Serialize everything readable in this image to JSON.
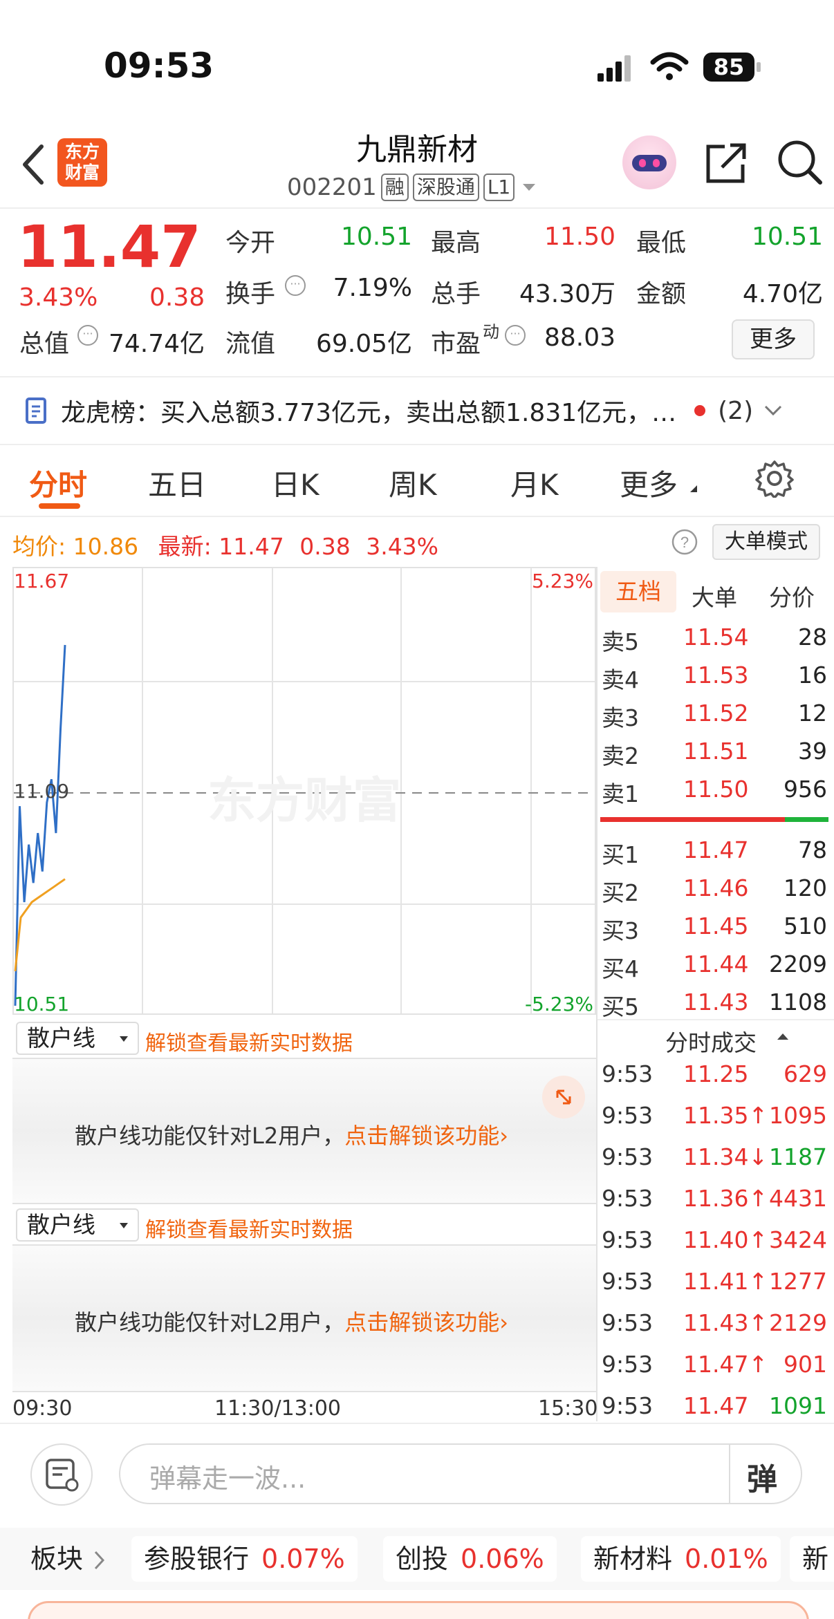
{
  "status_bar": {
    "time": "09:53",
    "battery": "85"
  },
  "header": {
    "title": "九鼎新材",
    "code": "002201",
    "tags": [
      "融",
      "深股通",
      "L1"
    ],
    "logo_text": "东方财富"
  },
  "quote": {
    "price": "11.47",
    "change_pct": "3.43%",
    "change": "0.38",
    "stats": [
      {
        "label": "今开",
        "value": "10.51",
        "color": "#13a32c"
      },
      {
        "label": "最高",
        "value": "11.50",
        "color": "#e8312e"
      },
      {
        "label": "最低",
        "value": "10.51",
        "color": "#13a32c"
      },
      {
        "label": "换手",
        "value": "7.19%",
        "color": "#222222"
      },
      {
        "label": "总手",
        "value": "43.30万",
        "color": "#222222"
      },
      {
        "label": "金额",
        "value": "4.70亿",
        "color": "#222222"
      },
      {
        "label": "总值",
        "value": "74.74亿",
        "color": "#222222"
      },
      {
        "label": "流值",
        "value": "69.05亿",
        "color": "#222222"
      },
      {
        "label": "市盈",
        "value": "88.03",
        "color": "#222222"
      }
    ],
    "pe_sup": "动",
    "more_label": "更多"
  },
  "dragon_tiger": {
    "text": "龙虎榜：买入总额3.773亿元，卖出总额1.831亿元，…",
    "count": "(2)"
  },
  "tabs": [
    "分时",
    "五日",
    "日K",
    "周K",
    "月K",
    "更多"
  ],
  "info_row": {
    "avg_label": "均价:",
    "avg_value": "10.86",
    "latest_label": "最新:",
    "latest_value": "11.47",
    "change": "0.38",
    "change_pct": "3.43%",
    "mode_button": "大单模式"
  },
  "chart": {
    "y_top": "11.67",
    "y_mid": "11.09",
    "y_bottom": "10.51",
    "pct_top": "5.23%",
    "pct_bottom": "-5.23%",
    "watermark": "东方财富",
    "x_labels": [
      "09:30",
      "11:30/13:00",
      "15:30"
    ]
  },
  "chart_data": {
    "type": "line",
    "x_range": [
      "09:30",
      "15:30"
    ],
    "ylim": [
      10.51,
      11.67
    ],
    "series": [
      {
        "values": [
          10.53,
          11.05,
          10.8,
          10.95,
          10.85,
          10.98,
          10.88,
          11.06,
          11.12,
          10.98,
          11.25,
          11.47
        ]
      },
      {
        "values": [
          10.62,
          10.76,
          10.78,
          10.8,
          10.81,
          10.82,
          10.83,
          10.84,
          10.85,
          10.86
        ]
      }
    ]
  },
  "order_book": {
    "tabs": [
      "五档",
      "大单",
      "分价"
    ],
    "asks": [
      {
        "label": "卖5",
        "price": "11.54",
        "vol": "28"
      },
      {
        "label": "卖4",
        "price": "11.53",
        "vol": "16"
      },
      {
        "label": "卖3",
        "price": "11.52",
        "vol": "12"
      },
      {
        "label": "卖2",
        "price": "11.51",
        "vol": "39"
      },
      {
        "label": "卖1",
        "price": "11.50",
        "vol": "956"
      }
    ],
    "bids": [
      {
        "label": "买1",
        "price": "11.47",
        "vol": "78"
      },
      {
        "label": "买2",
        "price": "11.46",
        "vol": "120"
      },
      {
        "label": "买3",
        "price": "11.45",
        "vol": "510"
      },
      {
        "label": "买4",
        "price": "11.44",
        "vol": "2209"
      },
      {
        "label": "买5",
        "price": "11.43",
        "vol": "1108"
      }
    ],
    "buy_ratio": 0.81
  },
  "trades": {
    "title": "分时成交",
    "rows": [
      {
        "time": "9:53",
        "price": "11.25",
        "vol": "629",
        "vol_color": "#e8312e"
      },
      {
        "time": "9:53",
        "price": "11.35↑",
        "vol": "1095",
        "vol_color": "#e8312e"
      },
      {
        "time": "9:53",
        "price": "11.34↓",
        "vol": "1187",
        "vol_color": "#13a32c"
      },
      {
        "time": "9:53",
        "price": "11.36↑",
        "vol": "4431",
        "vol_color": "#e8312e"
      },
      {
        "time": "9:53",
        "price": "11.40↑",
        "vol": "3424",
        "vol_color": "#e8312e"
      },
      {
        "time": "9:53",
        "price": "11.41↑",
        "vol": "1277",
        "vol_color": "#e8312e"
      },
      {
        "time": "9:53",
        "price": "11.43↑",
        "vol": "2129",
        "vol_color": "#e8312e"
      },
      {
        "time": "9:53",
        "price": "11.47↑",
        "vol": "901",
        "vol_color": "#e8312e"
      },
      {
        "time": "9:53",
        "price": "11.47",
        "vol": "1091",
        "vol_color": "#13a32c"
      }
    ]
  },
  "sub_panels": [
    {
      "select": "散户线",
      "link": "解锁查看最新实时数据",
      "msg": "散户线功能仅针对L2用户，",
      "msg_link": "点击解锁该功能"
    },
    {
      "select": "散户线",
      "link": "解锁查看最新实时数据",
      "msg": "散户线功能仅针对L2用户，",
      "msg_link": "点击解锁该功能"
    }
  ],
  "comment": {
    "placeholder": "弹幕走一波...",
    "danmu_label": "弹"
  },
  "ticker": {
    "label": "板块",
    "items": [
      {
        "name": "参股银行",
        "pct": "0.07%"
      },
      {
        "name": "创投",
        "pct": "0.06%"
      },
      {
        "name": "新材料",
        "pct": "0.01%"
      },
      {
        "name": "新",
        "pct": ""
      }
    ]
  }
}
